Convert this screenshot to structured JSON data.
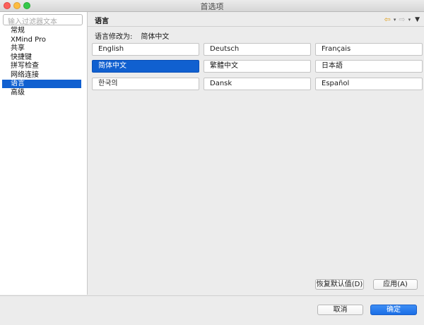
{
  "window": {
    "title": "首选项"
  },
  "sidebar": {
    "filter_placeholder": "输入过滤器文本",
    "items": [
      {
        "label": "常规"
      },
      {
        "label": "XMind Pro"
      },
      {
        "label": "共享"
      },
      {
        "label": "快捷键"
      },
      {
        "label": "拼写检查"
      },
      {
        "label": "网络连接"
      },
      {
        "label": "语言",
        "selected": true
      },
      {
        "label": "高级"
      }
    ]
  },
  "main": {
    "section_title": "语言",
    "change_label": "语言修改为:",
    "current_language": "简体中文",
    "languages": [
      {
        "label": "English"
      },
      {
        "label": "Deutsch"
      },
      {
        "label": "Français"
      },
      {
        "label": "简体中文",
        "selected": true
      },
      {
        "label": "繁體中文"
      },
      {
        "label": "日本語"
      },
      {
        "label": "한국의"
      },
      {
        "label": "Dansk"
      },
      {
        "label": "Español"
      }
    ],
    "restore_defaults_label": "恢复默认值(D)",
    "apply_label": "应用(A)"
  },
  "footer": {
    "cancel_label": "取消",
    "ok_label": "确定"
  },
  "colors": {
    "accent": "#1060d0",
    "primary_button": "#2a7cf0"
  }
}
